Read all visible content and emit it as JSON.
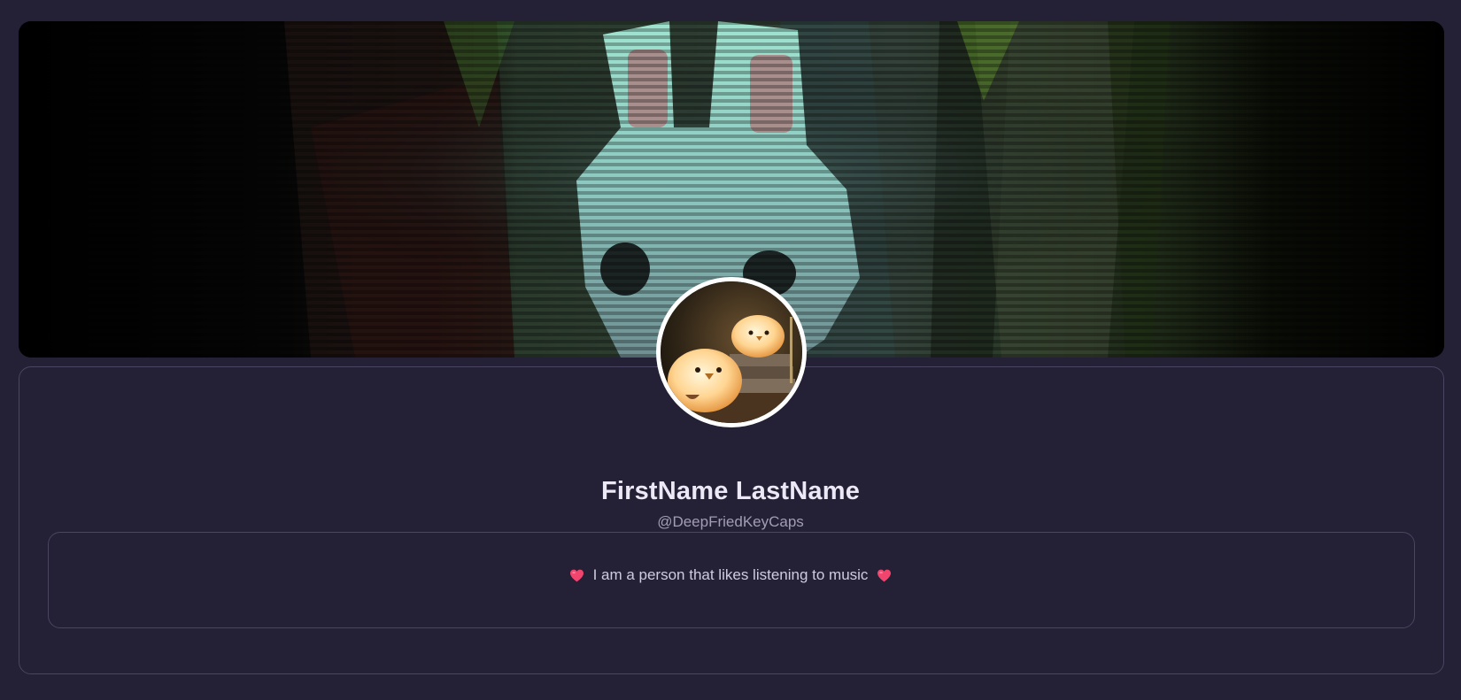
{
  "profile": {
    "name": "FirstName LastName",
    "username": "@DeepFriedKeyCaps",
    "bio": "I am a person that likes listening to music"
  },
  "icons": {
    "bio_left": "heart-icon",
    "bio_right": "heart-icon"
  },
  "colors": {
    "page_background": "#242036",
    "card_border": "#4a4560",
    "name_text": "#ece8f6",
    "username_text": "#a29db4",
    "bio_text": "#cfcbe0",
    "heart": "#f2456e",
    "avatar_border": "#ffffff"
  }
}
